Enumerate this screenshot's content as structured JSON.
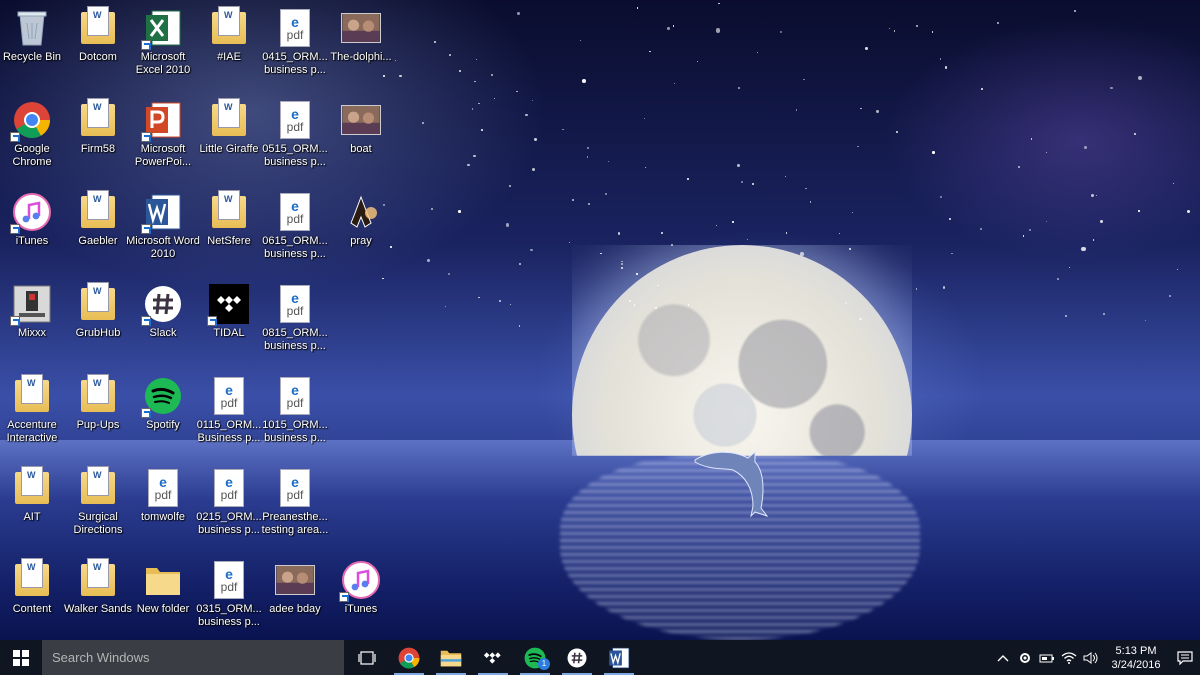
{
  "desktop": {
    "icons": [
      {
        "label": "Recycle Bin",
        "kind": "recycle-bin"
      },
      {
        "label": "Dotcom",
        "kind": "folder"
      },
      {
        "label": "Microsoft Excel 2010",
        "kind": "excel"
      },
      {
        "label": "#IAE",
        "kind": "folder"
      },
      {
        "label": "0415_ORM... business p...",
        "kind": "pdf"
      },
      {
        "label": "The-dolphi...",
        "kind": "photo"
      },
      {
        "label": "Google Chrome",
        "kind": "chrome"
      },
      {
        "label": "Firm58",
        "kind": "folder"
      },
      {
        "label": "Microsoft PowerPoi...",
        "kind": "powerpoint"
      },
      {
        "label": "Little Giraffe",
        "kind": "folder"
      },
      {
        "label": "0515_ORM... business p...",
        "kind": "pdf"
      },
      {
        "label": "boat",
        "kind": "photo"
      },
      {
        "label": "iTunes",
        "kind": "itunes"
      },
      {
        "label": "Gaebler",
        "kind": "folder"
      },
      {
        "label": "Microsoft Word 2010",
        "kind": "word"
      },
      {
        "label": "NetSfere",
        "kind": "folder"
      },
      {
        "label": "0615_ORM... business p...",
        "kind": "pdf"
      },
      {
        "label": "pray",
        "kind": "pray"
      },
      {
        "label": "Mixxx",
        "kind": "mixxx"
      },
      {
        "label": "GrubHub",
        "kind": "folder"
      },
      {
        "label": "Slack",
        "kind": "slack"
      },
      {
        "label": "TIDAL",
        "kind": "tidal"
      },
      {
        "label": "0815_ORM... business p...",
        "kind": "pdf"
      },
      {
        "label": "Accenture Interactive",
        "kind": "folder"
      },
      {
        "label": "Pup-Ups",
        "kind": "folder"
      },
      {
        "label": "Spotify",
        "kind": "spotify"
      },
      {
        "label": "0115_ORM... Business p...",
        "kind": "pdf"
      },
      {
        "label": "1015_ORM... business p...",
        "kind": "pdf"
      },
      {
        "label": "AIT",
        "kind": "folder"
      },
      {
        "label": "Surgical Directions",
        "kind": "folder"
      },
      {
        "label": "tomwolfe",
        "kind": "pdf"
      },
      {
        "label": "0215_ORM... business p...",
        "kind": "pdf"
      },
      {
        "label": "Preanesthe... testing area...",
        "kind": "pdf"
      },
      {
        "label": "Content",
        "kind": "folder"
      },
      {
        "label": "Walker Sands",
        "kind": "folder"
      },
      {
        "label": "New folder",
        "kind": "empty-folder"
      },
      {
        "label": "0315_ORM... business p...",
        "kind": "pdf"
      },
      {
        "label": "adee bday",
        "kind": "photo"
      },
      {
        "label": "iTunes",
        "kind": "itunes"
      }
    ],
    "pdf_icon_text": {
      "e": "e",
      "t": "pdf"
    }
  },
  "taskbar": {
    "search_placeholder": "Search Windows",
    "pinned": [
      {
        "name": "task-view",
        "icon": "task-view-icon"
      },
      {
        "name": "chrome",
        "icon": "chrome-icon"
      },
      {
        "name": "file-explorer",
        "icon": "folder-icon"
      },
      {
        "name": "tidal",
        "icon": "tidal-icon"
      },
      {
        "name": "spotify",
        "icon": "spotify-icon",
        "badge": "1"
      },
      {
        "name": "slack",
        "icon": "slack-icon"
      },
      {
        "name": "word",
        "icon": "word-icon"
      }
    ],
    "tray": {
      "time": "5:13 PM",
      "date": "3/24/2016"
    }
  },
  "colors": {
    "taskbar": "#101522",
    "search_box": "#3a3d44",
    "accent": "#7fa8de"
  }
}
